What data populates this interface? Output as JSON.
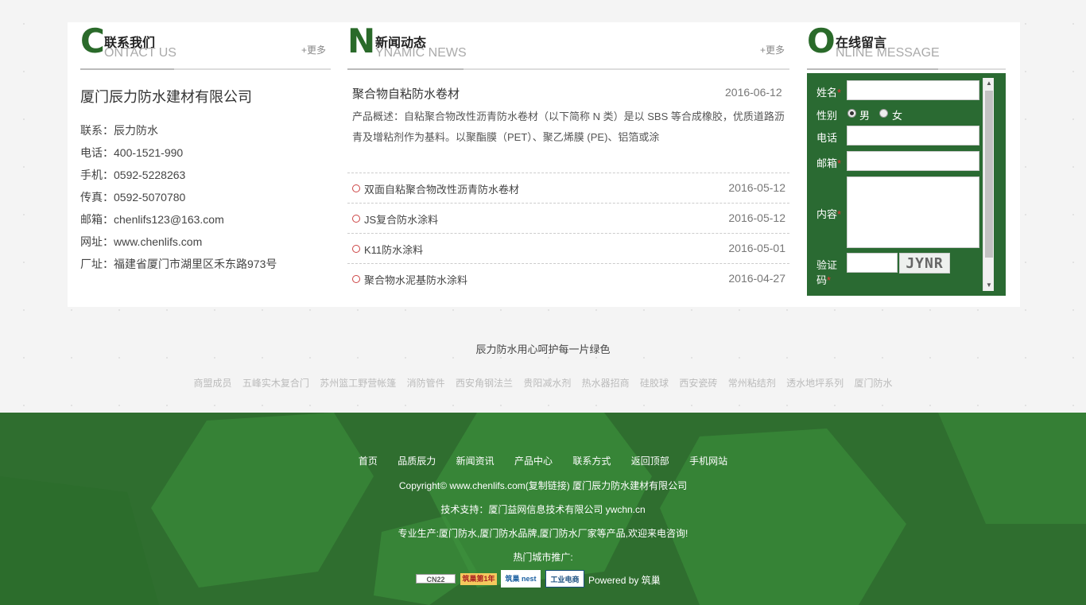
{
  "contact": {
    "title_cn": "联系我们",
    "title_letter": "C",
    "title_en": "ONTACT US",
    "more": "+更多",
    "company": "厦门辰力防水建材有限公司",
    "lines": [
      "联系：辰力防水",
      "电话：400-1521-990",
      "手机：0592-5228263",
      "传真：0592-5070780",
      "邮箱：chenlifs123@163.com",
      "网址：www.chenlifs.com",
      "厂址：福建省厦门市湖里区禾东路973号"
    ]
  },
  "news": {
    "title_cn": "新闻动态",
    "title_letter": "N",
    "title_en": "YNAMIC NEWS",
    "more": "+更多",
    "featured": {
      "title": "聚合物自粘防水卷材",
      "date": "2016-06-12",
      "desc": "产品概述：自粘聚合物改性沥青防水卷材（以下简称 N 类）是以 SBS 等合成橡胶，优质道路沥青及增粘剂作为基料。以聚酯膜（PET）、聚乙烯膜 (PE)、铝箔或涂"
    },
    "items": [
      {
        "title": "双面自粘聚合物改性沥青防水卷材",
        "date": "2016-05-12"
      },
      {
        "title": "JS复合防水涂料",
        "date": "2016-05-12"
      },
      {
        "title": "K11防水涂料",
        "date": "2016-05-01"
      },
      {
        "title": "聚合物水泥基防水涂料",
        "date": "2016-04-27"
      }
    ]
  },
  "message": {
    "title_cn": "在线留言",
    "title_letter": "O",
    "title_en": "NLINE MESSAGE",
    "name_label": "姓名",
    "gender_label": "性别",
    "male": "男",
    "female": "女",
    "phone_label": "电话",
    "email_label": "邮箱",
    "content_label": "内容",
    "captcha_label_1": "验证",
    "captcha_label_2": "码",
    "required_mark": "*",
    "captcha_text": "JYNR"
  },
  "slogan": "辰力防水用心呵护每一片绿色",
  "friend_links": [
    "商盟成员",
    "五峰实木复合门",
    "苏州篮工野营帐篷",
    "消防管件",
    "西安角钢法兰",
    "贵阳减水剂",
    "热水器招商",
    "硅胶球",
    "西安瓷砖",
    "常州粘结剂",
    "透水地坪系列",
    "厦门防水"
  ],
  "footer": {
    "nav": [
      "首页",
      "品质辰力",
      "新闻资讯",
      "产品中心",
      "联系方式",
      "返回顶部",
      "手机网站"
    ],
    "copyright": "Copyright© www.chenlifs.com(复制链接) 厦门辰力防水建材有限公司",
    "tech_support": "技术支持：厦门益网信息技术有限公司 ywchn.cn",
    "production": "专业生产:厦门防水,厦门防水品牌,厦门防水厂家等产品,欢迎来电咨询!",
    "hot_cities": "热门城市推广:",
    "badges": [
      "CN22",
      "筑巢第1年",
      "筑巢 nest",
      "工业电商"
    ],
    "powered": "Powered by 筑巢"
  }
}
